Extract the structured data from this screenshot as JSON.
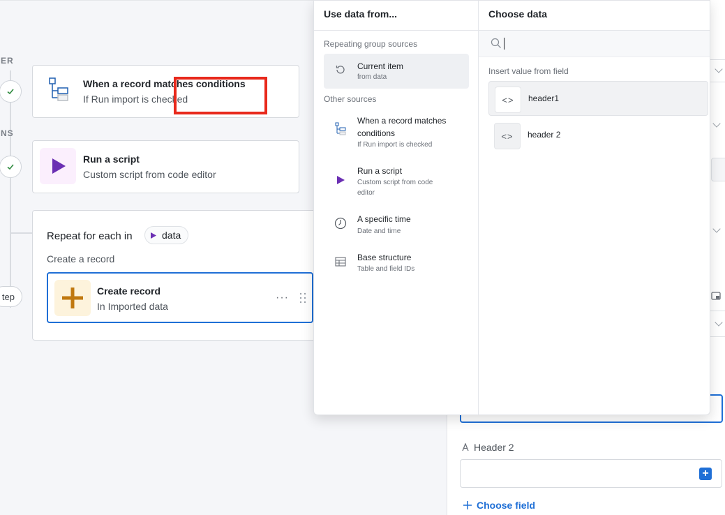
{
  "canvas": {
    "trigger_label": "ER",
    "actions_label": "NS",
    "step_button_label": "tep",
    "cards": [
      {
        "title": "When a record matches conditions",
        "subtitle": "If Run import is checked",
        "icon": "conditions-icon"
      },
      {
        "title": "Run a script",
        "subtitle": "Custom script from code editor",
        "icon": "play-icon"
      }
    ],
    "repeat": {
      "title": "Repeat for each in",
      "pill_label": "data",
      "subtitle": "Create a record",
      "inner_card": {
        "title": "Create record",
        "subtitle": "In Imported data",
        "icon": "plus-icon",
        "menu": "···"
      }
    }
  },
  "popup": {
    "left_header": "Use data from...",
    "right_header": "Choose data",
    "repeating_group_label": "Repeating group sources",
    "other_sources_label": "Other sources",
    "current_item": {
      "title": "Current item",
      "subtitle": "from data",
      "icon": "history-icon"
    },
    "other_sources": [
      {
        "title": "When a record matches conditions",
        "subtitle": "If Run import is checked",
        "icon": "conditions-icon"
      },
      {
        "title": "Run a script",
        "subtitle": "Custom script from code editor",
        "icon": "play-icon"
      },
      {
        "title": "A specific time",
        "subtitle": "Date and time",
        "icon": "clock-icon"
      },
      {
        "title": "Base structure",
        "subtitle": "Table and field IDs",
        "icon": "table-icon"
      }
    ],
    "search_placeholder": "",
    "insert_label": "Insert value from field",
    "fields": [
      {
        "label": "header1",
        "icon_text": "<>"
      },
      {
        "label": "header 2",
        "icon_text": "<>"
      }
    ]
  },
  "right_panel": {
    "field_label": "Header 2",
    "choose_field_label": "Choose field"
  },
  "colors": {
    "accent": "#1f6fd6",
    "highlight": "#e8291c",
    "script_purple": "#6b2fb3",
    "create_orange": "#c0780f"
  }
}
